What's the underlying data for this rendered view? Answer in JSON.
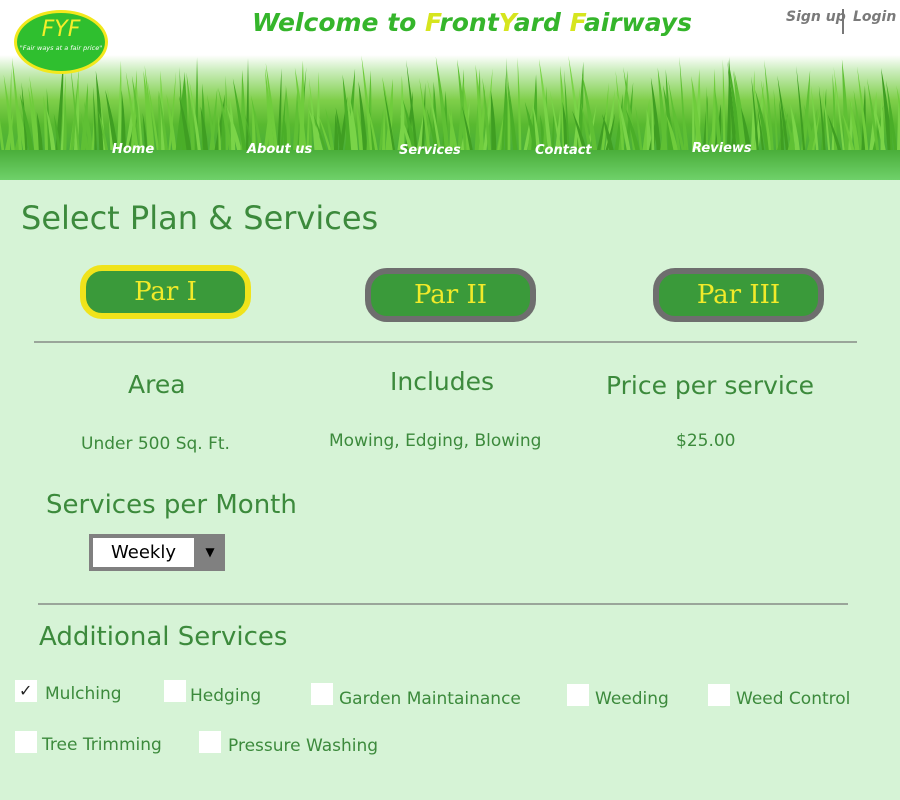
{
  "header": {
    "logo_abbr": "FYF",
    "logo_tagline": "\"Fair ways at a fair price\"",
    "welcome": {
      "prefix": "Welcome to ",
      "f1": "F",
      "p1": "ront",
      "y": "Y",
      "p2": "ard ",
      "f2": "F",
      "p3": "airways"
    },
    "sign_up": "Sign up",
    "login": "Login"
  },
  "nav": {
    "items": [
      {
        "label": "Home"
      },
      {
        "label": "About us"
      },
      {
        "label": "Services"
      },
      {
        "label": "Contact"
      },
      {
        "label": "Reviews"
      }
    ]
  },
  "page_title": "Select Plan & Services",
  "plans": [
    {
      "label": "Par I",
      "selected": true
    },
    {
      "label": "Par II",
      "selected": false
    },
    {
      "label": "Par III",
      "selected": false
    }
  ],
  "details": {
    "area_heading": "Area",
    "includes_heading": "Includes",
    "price_heading": "Price per service",
    "area_value": "Under 500 Sq. Ft.",
    "includes_value": "Mowing, Edging,  Blowing",
    "price_value": "$25.00"
  },
  "frequency": {
    "heading": "Services per Month",
    "selected": "Weekly",
    "arrow": "▼"
  },
  "additional": {
    "heading": "Additional Services",
    "items": [
      {
        "label": "Mulching",
        "checked": true
      },
      {
        "label": "Hedging",
        "checked": false
      },
      {
        "label": "Garden Maintainance",
        "checked": false
      },
      {
        "label": "Weeding",
        "checked": false
      },
      {
        "label": "Weed Control",
        "checked": false
      },
      {
        "label": "Tree Trimming",
        "checked": false
      },
      {
        "label": "Pressure Washing",
        "checked": false
      }
    ],
    "check_glyph": "✓"
  },
  "colors": {
    "background": "#d6f3d6",
    "brand_green": "#3c8a3c",
    "accent_yellow": "#f0e31b",
    "button_green": "#3a9a3a"
  }
}
